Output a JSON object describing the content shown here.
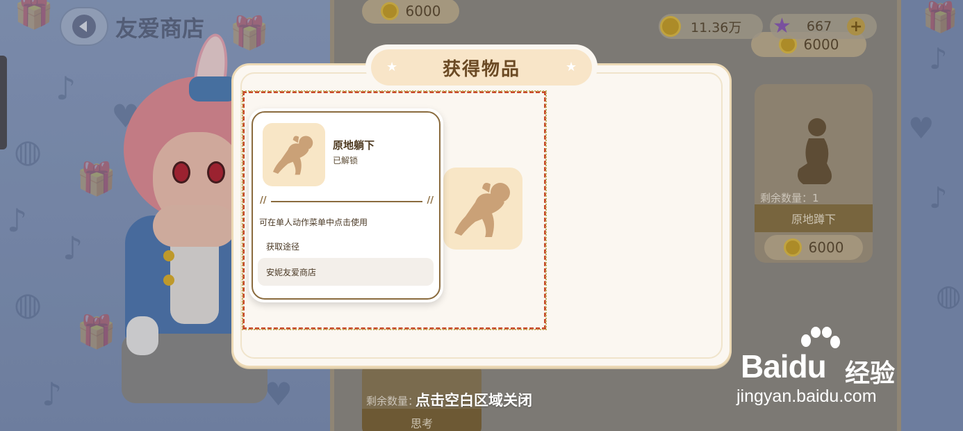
{
  "header": {
    "title": "友爱商店",
    "coins": "11.36万",
    "stars": "667",
    "plus": "+"
  },
  "shop_cards": [
    {
      "price": "6000"
    },
    {
      "price": "6000"
    },
    {
      "remaining": "剩余数量：1",
      "name": "原地蹲下",
      "price": "6000"
    },
    {
      "remaining": "剩余数量：",
      "name": "思考"
    }
  ],
  "modal": {
    "title": "获得物品",
    "item": {
      "name": "原地躺下",
      "status": "已解锁",
      "description": "可在单人动作菜单中点击使用",
      "acquire_label": "获取途径",
      "source": "安妮友爱商店"
    }
  },
  "close_hint": "点击空白区域关闭",
  "watermark": {
    "logo": "Baidu",
    "product": "经验",
    "url": "jingyan.baidu.com"
  },
  "colors": {
    "modal_bg": "#fbf7f1",
    "title_bg": "#f8e5c8",
    "item_bg": "#f8e6c6",
    "figure": "#caa177",
    "accent_brown": "#8a6b3e",
    "dashed_frame": "#c84b2a"
  }
}
